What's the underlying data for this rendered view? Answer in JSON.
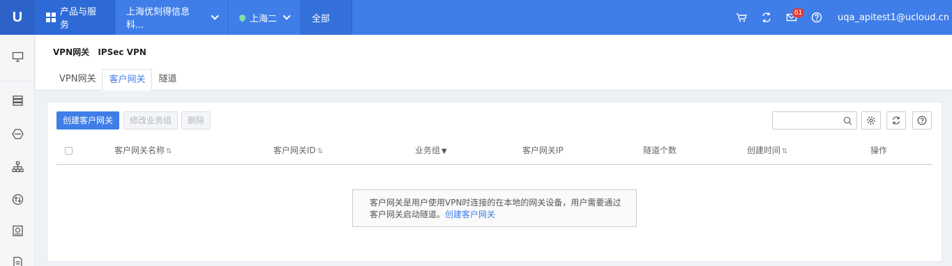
{
  "topbar": {
    "products_label": "产品与服务",
    "project_label": "上海优刻得信息科...",
    "region_label": "上海二",
    "all_label": "全部",
    "notification_count": "61",
    "user_email": "uqa_apitest1@ucloud.cn"
  },
  "breadcrumb": {
    "vpn_gateway": "VPN网关",
    "ipsec": "IPSec VPN"
  },
  "tabs": [
    {
      "label": "VPN网关"
    },
    {
      "label": "客户网关"
    },
    {
      "label": "隧道"
    }
  ],
  "toolbar": {
    "create_label": "创建客户网关",
    "modify_group_label": "修改业务组",
    "delete_label": "删除",
    "search_placeholder": ""
  },
  "table": {
    "headers": {
      "name": "客户网关名称",
      "id": "客户网关ID",
      "group": "业务组",
      "ip": "客户网关IP",
      "tunnel_count": "隧道个数",
      "created": "创建时间",
      "actions": "操作"
    },
    "sort_glyph": "⇅",
    "filter_glyph": "▼"
  },
  "empty_state": {
    "line1": "客户网关是用户使用VPN时连接的在本地的网关设备，用户需要通过",
    "line2_prefix": "客户网关启动隧道。",
    "link": "创建客户网关"
  },
  "colors": {
    "brand": "#3f7ee8",
    "topbar_dark": "#2d63c8",
    "badge": "#e53935"
  },
  "icons": {
    "top": [
      "cart-icon",
      "sync-icon",
      "mail-icon",
      "help-icon"
    ],
    "sidebar": [
      "monitor-icon",
      "database-icon",
      "hexagon-icon",
      "network-icon",
      "transfer-icon",
      "storage-icon",
      "document-icon"
    ],
    "tools": [
      "search-icon",
      "gear-icon",
      "refresh-icon",
      "question-icon"
    ]
  }
}
